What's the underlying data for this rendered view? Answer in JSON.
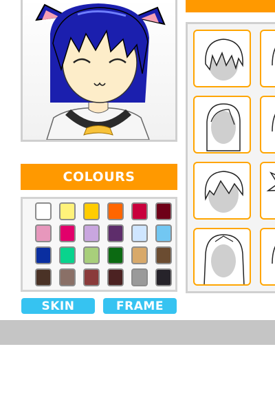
{
  "colours": {
    "title": "COLOURS",
    "swatches": [
      "#ffffff",
      "#fff27a",
      "#ffcc00",
      "#ff6600",
      "#c8003c",
      "#6e0018",
      "#e797bc",
      "#e2006b",
      "#c9a6df",
      "#5e2d6b",
      "#cfe6ff",
      "#72c7f2",
      "#0a2ea0",
      "#09d38d",
      "#a8cf7b",
      "#0c6a12",
      "#d8a96a",
      "#6b4c31",
      "#4a3226",
      "#8a7067",
      "#8a3b3b",
      "#4c2222",
      "#9a9a9a",
      "#26232a"
    ]
  },
  "buttons": {
    "skin": "SKIN",
    "frame": "FRAME"
  },
  "hair_panel": {
    "tiles": [
      {
        "icon": "short-messy-hair-icon"
      },
      {
        "icon": "hair-icon"
      },
      {
        "icon": "long-straight-hair-icon"
      },
      {
        "icon": "hair-icon"
      },
      {
        "icon": "side-swept-hair-icon"
      },
      {
        "icon": "spiky-hair-icon"
      },
      {
        "icon": "long-layered-hair-icon"
      },
      {
        "icon": "hair-icon"
      }
    ]
  },
  "theme": {
    "accent": "#ff9900",
    "button": "#36c3f1",
    "panel_border": "#d0d0d0",
    "footer": "#c5c5c5"
  }
}
